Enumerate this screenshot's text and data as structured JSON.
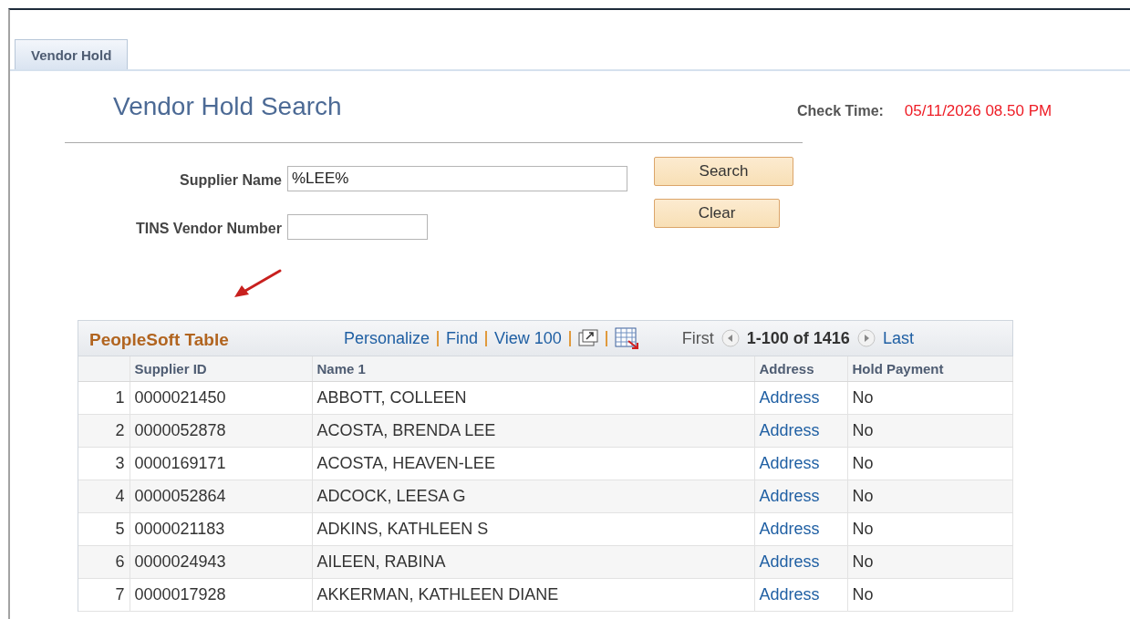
{
  "tab": {
    "label": "Vendor Hold",
    "selected": true
  },
  "page_title": "Vendor Hold Search",
  "check_time": {
    "label": "Check Time:",
    "value": "05/11/2026 08.50 PM"
  },
  "fields": [
    {
      "label": "Supplier Name",
      "value": "%LEE%",
      "kind": "wide"
    },
    {
      "label": "TINS Vendor Number",
      "kind": "narrow"
    }
  ],
  "buttons": [
    "Search",
    "Clear"
  ],
  "grid": {
    "title": "PeopleSoft Table",
    "links": [
      "Personalize",
      "Find",
      "View 100"
    ],
    "nav": {
      "first": "First",
      "range": "1-100 of 1416",
      "last": "Last"
    },
    "columns": [
      "Supplier ID",
      "Name 1",
      "Address",
      "Hold Payment"
    ],
    "rows": [
      {
        "number": "1",
        "supplier_id": "0000021450",
        "name": "ABBOTT, COLLEEN",
        "address": "Address",
        "hold_payment": "No"
      },
      {
        "number": "2",
        "supplier_id": "0000052878",
        "name": "ACOSTA, BRENDA LEE",
        "address": "Address",
        "hold_payment": "No"
      },
      {
        "number": "3",
        "supplier_id": "0000169171",
        "name": "ACOSTA, HEAVEN-LEE",
        "address": "Address",
        "hold_payment": "No"
      },
      {
        "number": "4",
        "supplier_id": "0000052864",
        "name": "ADCOCK, LEESA G",
        "address": "Address",
        "hold_payment": "No"
      },
      {
        "number": "5",
        "supplier_id": "0000021183",
        "name": "ADKINS, KATHLEEN S",
        "address": "Address",
        "hold_payment": "No"
      },
      {
        "number": "6",
        "supplier_id": "0000024943",
        "name": "AILEEN, RABINA",
        "address": "Address",
        "hold_payment": "No"
      },
      {
        "number": "7",
        "supplier_id": "0000017928",
        "name": "AKKERMAN, KATHLEEN DIANE",
        "address": "Address",
        "hold_payment": "No"
      }
    ]
  }
}
